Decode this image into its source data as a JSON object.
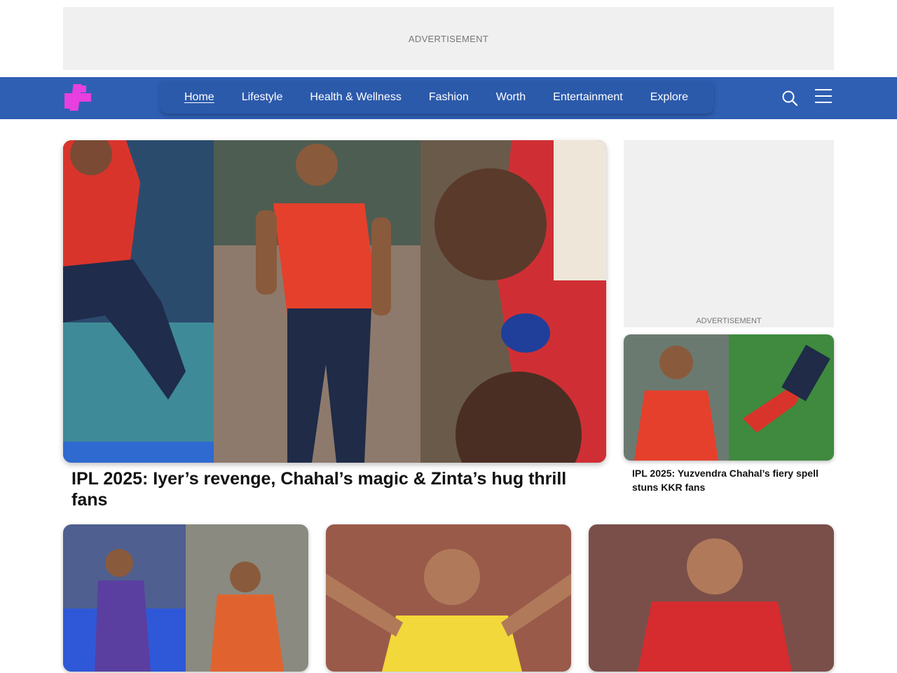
{
  "ads": {
    "top_label": "ADVERTISEMENT",
    "side_label": "ADVERTISEMENT"
  },
  "header": {
    "logo_icon": "plus-logo-icon",
    "brand_color": "#2f5fb3",
    "logo_color": "#e83fe0",
    "nav": [
      {
        "label": "Home",
        "active": true
      },
      {
        "label": "Lifestyle"
      },
      {
        "label": "Health & Wellness"
      },
      {
        "label": "Fashion"
      },
      {
        "label": "Worth"
      },
      {
        "label": "Entertainment"
      },
      {
        "label": "Explore"
      }
    ],
    "search_icon": "search-icon",
    "menu_icon": "hamburger-menu-icon"
  },
  "hero": {
    "image_desc": "collage of three cricket players celebrating",
    "title": "IPL 2025: Iyer’s revenge, Chahal’s magic & Zinta’s hug thrill fans"
  },
  "side_story": {
    "image_desc": "cricketer celebrating and diving catch",
    "title": "IPL 2025: Yuzvendra Chahal’s fiery spell stuns KKR fans"
  },
  "cards": [
    {
      "image_desc": "two players in purple and orange jerseys"
    },
    {
      "image_desc": "player in yellow jersey shouting"
    },
    {
      "image_desc": "smiling player in red jersey"
    }
  ]
}
